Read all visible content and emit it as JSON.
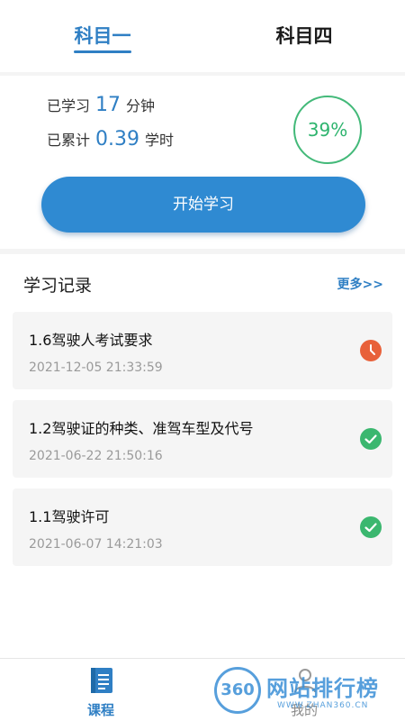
{
  "tabs": [
    {
      "label": "科目一",
      "active": true
    },
    {
      "label": "科目四",
      "active": false
    }
  ],
  "stats": {
    "studied_prefix": "已学习",
    "studied_value": "17",
    "studied_unit": "分钟",
    "total_prefix": "已累计",
    "total_value": "0.39",
    "total_unit": "学时",
    "progress_percent": "39%"
  },
  "start_button": "开始学习",
  "records": {
    "title": "学习记录",
    "more": "更多>>",
    "items": [
      {
        "name": "1.6驾驶人考试要求",
        "time": "2021-12-05 21:33:59",
        "status_icon": "clock-icon"
      },
      {
        "name": "1.2驾驶证的种类、准驾车型及代号",
        "time": "2021-06-22 21:50:16",
        "status_icon": "check-icon"
      },
      {
        "name": "1.1驾驶许可",
        "time": "2021-06-07 14:21:03",
        "status_icon": "check-icon"
      }
    ]
  },
  "bottom_nav": [
    {
      "label": "课程",
      "icon": "book-icon",
      "active": true
    },
    {
      "label": "我的",
      "icon": "user-icon",
      "active": false
    }
  ],
  "watermark": {
    "logo": "360",
    "text": "网站排行榜",
    "sub": "WWW.ZHAN360.CN"
  },
  "colors": {
    "accent": "#2f7fc4",
    "progress": "#2eb46e",
    "clock": "#e8613a",
    "check": "#3bb76f"
  }
}
